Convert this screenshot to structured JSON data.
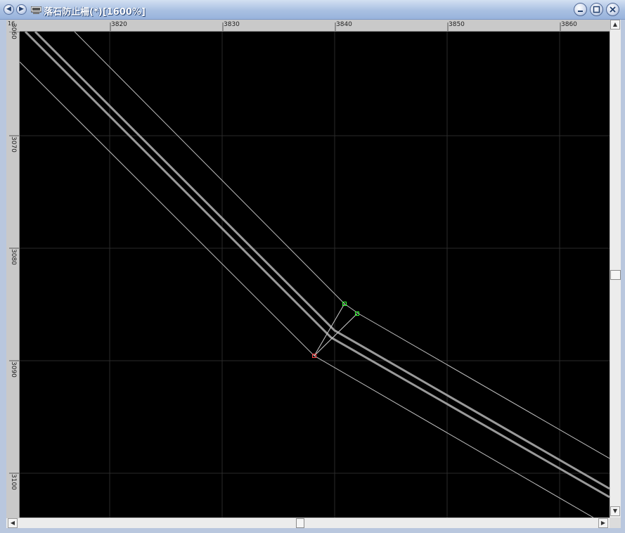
{
  "window": {
    "title": "落石防止柵(*)[1600%]"
  },
  "titlebar_buttons": [
    "scroll-left-icon",
    "scroll-right-icon"
  ],
  "window_controls": [
    "minimize-icon",
    "maximize-icon",
    "close-icon"
  ],
  "ruler": {
    "corner_label": "16",
    "x_ticks": [
      "3820",
      "3830",
      "3840",
      "3850",
      "3860"
    ],
    "y_ticks": [
      "3060",
      "3070",
      "3080",
      "3090",
      "3100"
    ]
  },
  "colors": {
    "canvas_bg": "#000000",
    "grid": "#2a2a2a",
    "edge_line": "#bfbfbf",
    "center_line": "#9a9a9a",
    "handle_green": "#33ff33",
    "handle_red": "#ff4444"
  }
}
